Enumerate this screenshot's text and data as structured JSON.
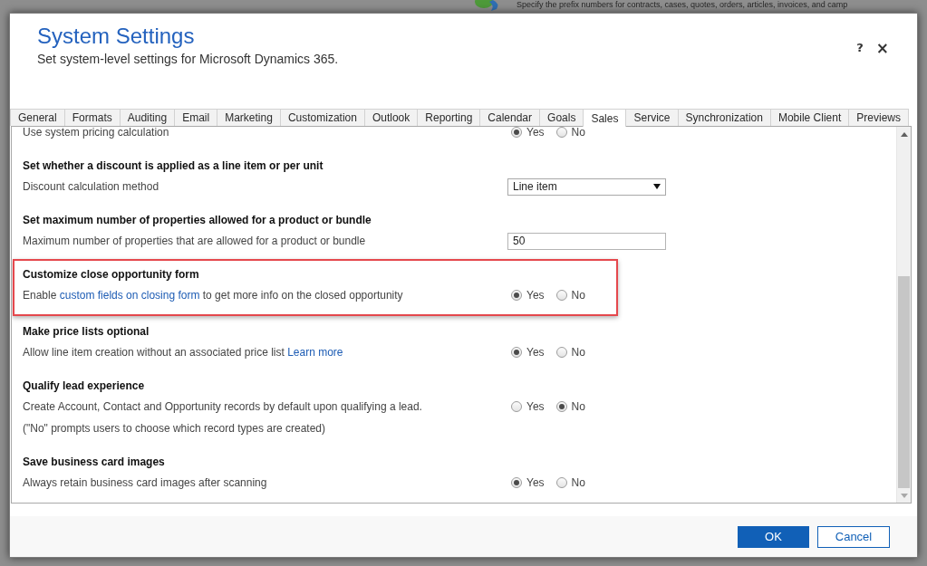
{
  "background": {
    "text": "Specify the prefix numbers for contracts, cases, quotes, orders, articles, invoices, and camp"
  },
  "dialog": {
    "title": "System Settings",
    "subtitle": "Set system-level settings for Microsoft Dynamics 365.",
    "help": "?",
    "close": "×"
  },
  "tabs": [
    {
      "label": "General",
      "selected": false
    },
    {
      "label": "Formats",
      "selected": false
    },
    {
      "label": "Auditing",
      "selected": false
    },
    {
      "label": "Email",
      "selected": false
    },
    {
      "label": "Marketing",
      "selected": false
    },
    {
      "label": "Customization",
      "selected": false
    },
    {
      "label": "Outlook",
      "selected": false
    },
    {
      "label": "Reporting",
      "selected": false
    },
    {
      "label": "Calendar",
      "selected": false
    },
    {
      "label": "Goals",
      "selected": false
    },
    {
      "label": "Sales",
      "selected": true
    },
    {
      "label": "Service",
      "selected": false
    },
    {
      "label": "Synchronization",
      "selected": false
    },
    {
      "label": "Mobile Client",
      "selected": false
    },
    {
      "label": "Previews",
      "selected": false
    }
  ],
  "sections": [
    {
      "highlighted": false,
      "rows": [
        {
          "kind": "radio",
          "label": [
            {
              "text": "Use system pricing calculation",
              "link": false
            }
          ],
          "options": [
            {
              "label": "Yes",
              "selected": true
            },
            {
              "label": "No",
              "selected": false
            }
          ]
        }
      ]
    },
    {
      "heading": "Set whether a discount is applied as a line item or per unit",
      "highlighted": false,
      "rows": [
        {
          "kind": "dropdown",
          "label": [
            {
              "text": "Discount calculation method",
              "link": false
            }
          ],
          "value": "Line item"
        }
      ]
    },
    {
      "heading": "Set maximum number of properties allowed for a product or bundle",
      "highlighted": false,
      "rows": [
        {
          "kind": "input",
          "label": [
            {
              "text": "Maximum number of properties that are allowed for a product or bundle",
              "link": false
            }
          ],
          "value": "50"
        }
      ]
    },
    {
      "heading": "Customize close opportunity form",
      "highlighted": true,
      "rows": [
        {
          "kind": "radio",
          "label": [
            {
              "text": "Enable ",
              "link": false
            },
            {
              "text": "custom fields on closing form",
              "link": true
            },
            {
              "text": " to get more info on the closed opportunity",
              "link": false
            }
          ],
          "options": [
            {
              "label": "Yes",
              "selected": true
            },
            {
              "label": "No",
              "selected": false
            }
          ]
        }
      ]
    },
    {
      "heading": "Make price lists optional",
      "highlighted": false,
      "rows": [
        {
          "kind": "radio",
          "label": [
            {
              "text": "Allow line item creation without an associated price list ",
              "link": false
            },
            {
              "text": "Learn more",
              "link": true
            }
          ],
          "options": [
            {
              "label": "Yes",
              "selected": true
            },
            {
              "label": "No",
              "selected": false
            }
          ]
        }
      ]
    },
    {
      "heading": "Qualify lead experience",
      "highlighted": false,
      "rows": [
        {
          "kind": "radio",
          "label": [
            {
              "text": "Create Account, Contact and Opportunity records by default upon qualifying a lead.",
              "link": false
            }
          ],
          "options": [
            {
              "label": "Yes",
              "selected": false
            },
            {
              "label": "No",
              "selected": true
            }
          ]
        },
        {
          "kind": "note",
          "label": [
            {
              "text": "(\"No\" prompts users to choose which record types are created)",
              "link": false
            }
          ]
        }
      ]
    },
    {
      "heading": "Save business card images",
      "highlighted": false,
      "rows": [
        {
          "kind": "radio",
          "label": [
            {
              "text": "Always retain business card images after scanning",
              "link": false
            }
          ],
          "options": [
            {
              "label": "Yes",
              "selected": true
            },
            {
              "label": "No",
              "selected": false
            }
          ]
        }
      ]
    }
  ],
  "buttons": [
    {
      "label": "OK",
      "kind": "primary"
    },
    {
      "label": "Cancel",
      "kind": "secondary"
    }
  ]
}
